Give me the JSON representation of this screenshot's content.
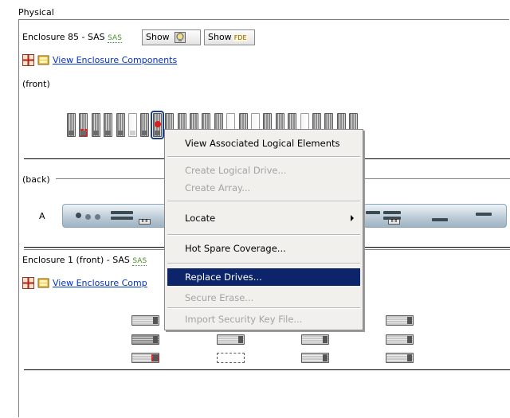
{
  "panel": {
    "title": "Physical"
  },
  "enclosure85": {
    "title": "Enclosure 85 - SAS",
    "badge": "SAS",
    "show_button": "Show",
    "show_fde_button": "Show",
    "fde_tag": "FDE",
    "view_link": "View Enclosure Components",
    "front_label": "(front)",
    "back_label": "(back)",
    "controller_a_label": "A",
    "port_label": "8 8"
  },
  "enclosure1": {
    "title": "Enclosure 1 (front) - SAS",
    "badge": "SAS",
    "view_link": "View Enclosure Comp"
  },
  "context_menu": {
    "items": [
      {
        "label": "View Associated Logical Elements",
        "enabled": true
      },
      {
        "label": "Create Logical Drive...",
        "enabled": false
      },
      {
        "label": "Create Array...",
        "enabled": false
      },
      {
        "label": "Locate",
        "enabled": true,
        "submenu": true
      },
      {
        "label": "Hot Spare Coverage...",
        "enabled": true
      },
      {
        "label": "Replace Drives...",
        "enabled": true,
        "selected": true
      },
      {
        "label": "Secure Erase...",
        "enabled": false
      },
      {
        "label": "Import Security Key File...",
        "enabled": false
      }
    ]
  },
  "colors": {
    "menu_selection": "#0b246a",
    "link": "#0033cc",
    "badge": "#4a8f2b"
  },
  "icons": [
    "enclosure-components-icon",
    "enclosure-view-icon",
    "hot-spare-icon",
    "failed-drive-icon",
    "submenu-arrow-icon"
  ]
}
